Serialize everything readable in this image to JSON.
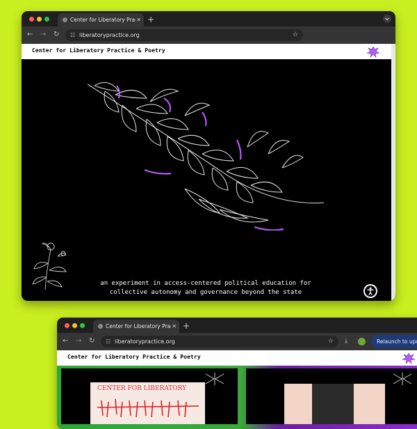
{
  "browser": {
    "tab_title": "Center for Liberatory Practice",
    "url": "liberatorypractice.org",
    "relaunch_label": "Relaunch to update"
  },
  "site": {
    "title": "Center for Liberatory Practice & Poetry",
    "tagline_line1": "an experiment in access-centered political education for",
    "tagline_line2": "collective autonomy and governance beyond the state"
  },
  "poster": {
    "text": "CENTER FOR LIBERATORY"
  },
  "colors": {
    "background": "#c8ef1f",
    "accent_purple": "#b35cf5",
    "relaunch_button": "#1f3a78"
  },
  "icons": [
    "back-icon",
    "forward-icon",
    "reload-icon",
    "site-info-icon",
    "star-icon",
    "download-icon",
    "profile-icon",
    "accessibility-icon",
    "chevron-down-icon",
    "close-icon",
    "new-tab-icon"
  ]
}
